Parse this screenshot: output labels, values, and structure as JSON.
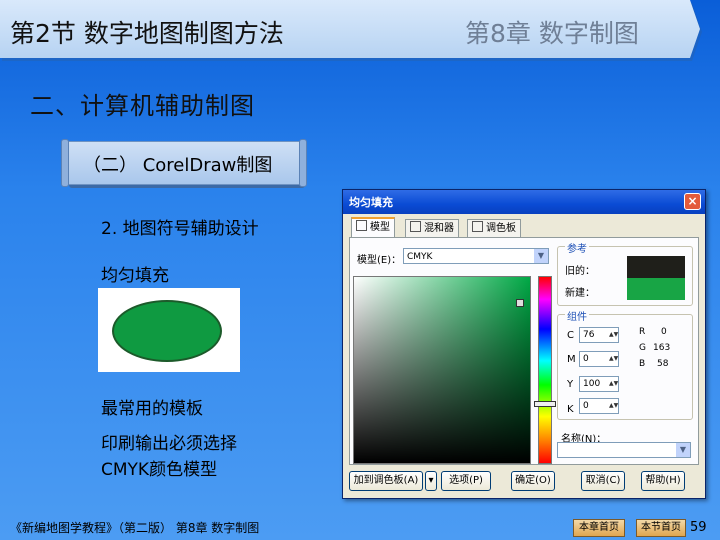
{
  "header": {
    "section_title": "第2节  数字地图制图方法",
    "chapter_title": "第8章  数字制图"
  },
  "heading": "二、计算机辅助制图",
  "scroll_label": "（二） CorelDraw制图",
  "content": {
    "item1": "2. 地图符号辅助设计",
    "item2": "均匀填充",
    "item3": "最常用的模板",
    "item4_line1": "印刷输出必须选择",
    "item4_line2": "CMYK颜色模型"
  },
  "swatch_color": "#0f9a41",
  "dialog": {
    "title": "均匀填充",
    "close": "×",
    "tabs": [
      {
        "label": "模型",
        "active": true,
        "icon": "model-icon"
      },
      {
        "label": "混和器",
        "active": false,
        "icon": "mixer-icon"
      },
      {
        "label": "调色板",
        "active": false,
        "icon": "palette-icon"
      }
    ],
    "model_label": "模型(E)：",
    "model_value": "CMYK",
    "reference": {
      "title": "参考",
      "old_label": "旧的：",
      "new_label": "新建：",
      "old_color": "#1f1f1a",
      "new_color": "#18a545"
    },
    "components": {
      "title": "组件",
      "fields": [
        {
          "label": "C",
          "value": "76"
        },
        {
          "label": "M",
          "value": "0"
        },
        {
          "label": "Y",
          "value": "100"
        },
        {
          "label": "K",
          "value": "0"
        }
      ],
      "rgb": [
        {
          "label": "R",
          "value": "0"
        },
        {
          "label": "G",
          "value": "163"
        },
        {
          "label": "B",
          "value": "58"
        }
      ]
    },
    "name_label": "名称(N)：",
    "buttons": {
      "add_palette": "加到调色板(A)",
      "options": "选项(P)",
      "ok": "确定(O)",
      "cancel": "取消(C)",
      "help": "帮助(H)"
    }
  },
  "footer": {
    "book": "《新编地图学教程》（第二版）  第8章  数字制图",
    "chapter_home": "本章首页",
    "section_home": "本节首页",
    "page": "59"
  }
}
